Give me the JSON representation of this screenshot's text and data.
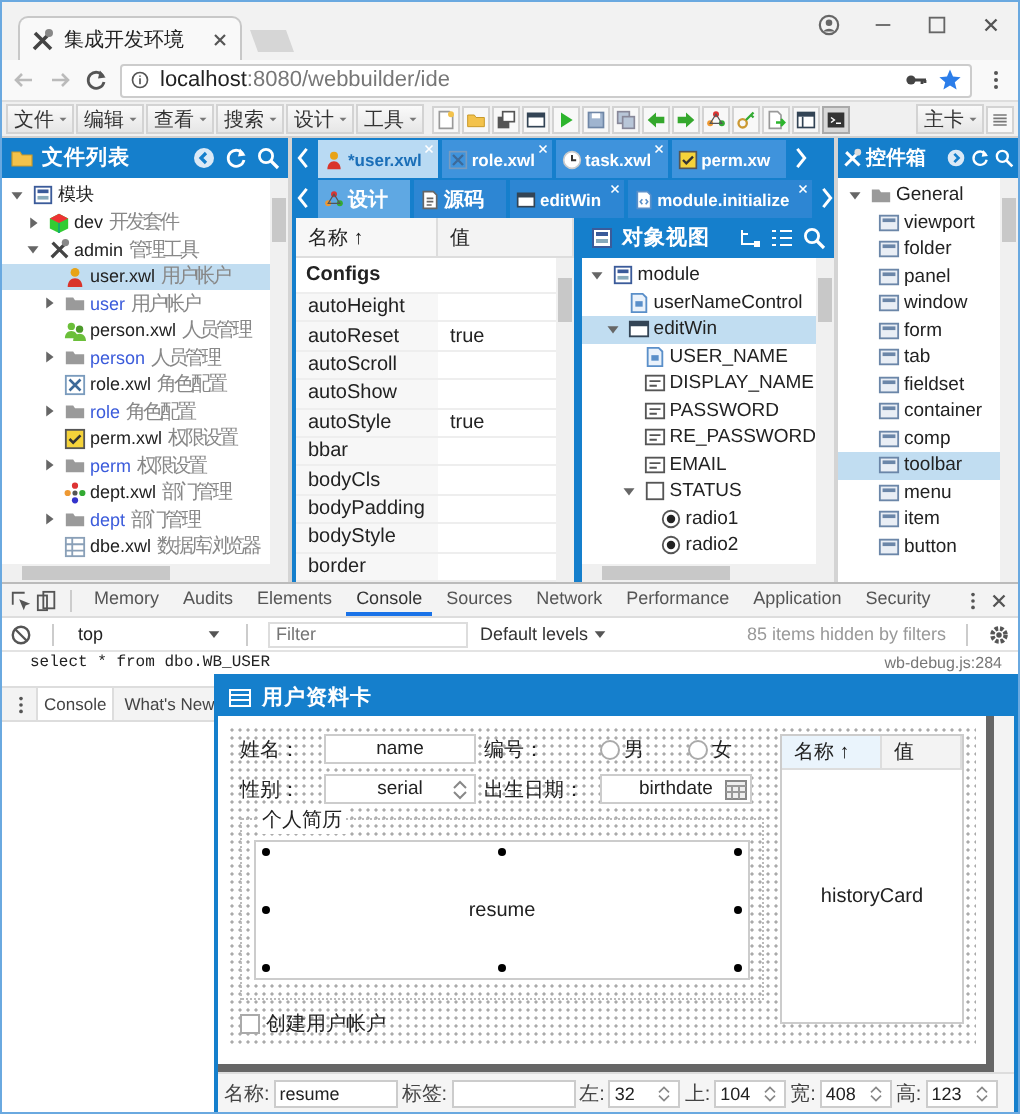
{
  "browser": {
    "tab_title": "集成开发环境",
    "url_host": "localhost",
    "url_path": ":8080/webbuilder/ide"
  },
  "menubar": {
    "menus": [
      "文件",
      "编辑",
      "查看",
      "搜索",
      "设计",
      "工具"
    ],
    "card_menu": "主卡"
  },
  "files": {
    "title": "文件列表",
    "tree": [
      {
        "label": "模块",
        "kind": "module",
        "expanded": true,
        "selected": false,
        "children": [
          {
            "label": "dev",
            "note": "开发套件",
            "kind": "kit",
            "expanded": false,
            "selected": false
          },
          {
            "label": "admin",
            "note": "管理工具",
            "kind": "tools",
            "expanded": true,
            "selected": false,
            "children": [
              {
                "label": "user.xwl",
                "note": "用户帐户",
                "kind": "user",
                "selected": true
              },
              {
                "label": "user",
                "note": "用户帐户",
                "kind": "folder",
                "expanded": false,
                "selected": false
              },
              {
                "label": "person.xwl",
                "note": "人员管理",
                "kind": "people",
                "selected": false
              },
              {
                "label": "person",
                "note": "人员管理",
                "kind": "folder",
                "expanded": false,
                "selected": false
              },
              {
                "label": "role.xwl",
                "note": "角色配置",
                "kind": "role",
                "selected": false
              },
              {
                "label": "role",
                "note": "角色配置",
                "kind": "folder",
                "expanded": false,
                "selected": false
              },
              {
                "label": "perm.xwl",
                "note": "权限设置",
                "kind": "perm",
                "selected": false
              },
              {
                "label": "perm",
                "note": "权限设置",
                "kind": "folder",
                "expanded": false,
                "selected": false
              },
              {
                "label": "dept.xwl",
                "note": "部门管理",
                "kind": "dept",
                "selected": false
              },
              {
                "label": "dept",
                "note": "部门管理",
                "kind": "folder",
                "expanded": false,
                "selected": false
              },
              {
                "label": "dbe.xwl",
                "note": "数据库浏览器",
                "kind": "db",
                "selected": false
              }
            ]
          }
        ]
      }
    ]
  },
  "editor": {
    "tabs": [
      {
        "label": "*user.xwl",
        "kind": "user",
        "selected": true,
        "closable": true
      },
      {
        "label": "role.xwl",
        "kind": "role",
        "selected": false,
        "closable": true
      },
      {
        "label": "task.xwl",
        "kind": "task",
        "selected": false,
        "closable": true
      },
      {
        "label": "perm.xw",
        "kind": "perm",
        "selected": false,
        "closable": false
      }
    ],
    "subtabs": [
      {
        "label": "设计",
        "kind": "design",
        "selected": true,
        "closable": false
      },
      {
        "label": "源码",
        "kind": "source",
        "selected": false,
        "closable": false
      },
      {
        "label": "editWin",
        "kind": "window",
        "selected": false,
        "closable": true
      },
      {
        "label": "module.initialize",
        "kind": "script",
        "selected": false,
        "closable": true
      }
    ],
    "properties": {
      "columns": [
        "名称 ↑",
        "值"
      ],
      "group": "Configs",
      "rows": [
        {
          "name": "autoHeight"
        },
        {
          "name": "autoReset",
          "value": "true"
        },
        {
          "name": "autoScroll"
        },
        {
          "name": "autoShow"
        },
        {
          "name": "autoStyle",
          "value": "true"
        },
        {
          "name": "bbar"
        },
        {
          "name": "bodyCls"
        },
        {
          "name": "bodyPadding"
        },
        {
          "name": "bodyStyle"
        },
        {
          "name": "border"
        }
      ]
    },
    "objects": {
      "title": "对象视图",
      "tree": [
        {
          "label": "module",
          "kind": "module",
          "expanded": true,
          "selected": false,
          "children": [
            {
              "label": "userNameControl",
              "kind": "control",
              "selected": false
            },
            {
              "label": "editWin",
              "kind": "window",
              "expanded": true,
              "selected": true,
              "children": [
                {
                  "label": "USER_NAME",
                  "kind": "control",
                  "selected": false
                },
                {
                  "label": "DISPLAY_NAME",
                  "kind": "text",
                  "selected": false
                },
                {
                  "label": "PASSWORD",
                  "kind": "text",
                  "selected": false
                },
                {
                  "label": "RE_PASSWORD",
                  "kind": "text",
                  "selected": false
                },
                {
                  "label": "EMAIL",
                  "kind": "text",
                  "selected": false
                },
                {
                  "label": "STATUS",
                  "kind": "container",
                  "expanded": true,
                  "selected": false,
                  "children": [
                    {
                      "label": "radio1",
                      "kind": "radio",
                      "selected": false
                    },
                    {
                      "label": "radio2",
                      "kind": "radio",
                      "selected": false
                    }
                  ]
                }
              ]
            }
          ]
        }
      ]
    }
  },
  "toolbox": {
    "title": "控件箱",
    "group": {
      "label": "General",
      "expanded": true
    },
    "items": [
      {
        "label": "viewport",
        "selected": false
      },
      {
        "label": "folder",
        "selected": false
      },
      {
        "label": "panel",
        "selected": false
      },
      {
        "label": "window",
        "selected": false
      },
      {
        "label": "form",
        "selected": false
      },
      {
        "label": "tab",
        "selected": false
      },
      {
        "label": "fieldset",
        "selected": false
      },
      {
        "label": "container",
        "selected": false
      },
      {
        "label": "comp",
        "selected": false
      },
      {
        "label": "toolbar",
        "selected": true
      },
      {
        "label": "menu",
        "selected": false
      },
      {
        "label": "item",
        "selected": false
      },
      {
        "label": "button",
        "selected": false
      }
    ]
  },
  "devtools": {
    "tabs": [
      {
        "label": "Memory",
        "selected": false
      },
      {
        "label": "Audits",
        "selected": false
      },
      {
        "label": "Elements",
        "selected": false
      },
      {
        "label": "Console",
        "selected": true
      },
      {
        "label": "Sources",
        "selected": false
      },
      {
        "label": "Network",
        "selected": false
      },
      {
        "label": "Performance",
        "selected": false
      },
      {
        "label": "Application",
        "selected": false
      },
      {
        "label": "Security",
        "selected": false
      }
    ],
    "context": "top",
    "filter_placeholder": "Filter",
    "levels": "Default levels",
    "hidden_note": "85 items hidden by filters",
    "console": [
      {
        "text": "select * from dbo.WB_USER",
        "source": "wb-debug.js:284"
      }
    ],
    "drawer_tabs": [
      {
        "label": "Console",
        "selected": true
      },
      {
        "label": "What's New",
        "selected": false
      }
    ]
  },
  "designer": {
    "title": "用户资料卡",
    "fields": [
      {
        "label": "姓名：",
        "kind": "text",
        "value": "name"
      },
      {
        "label": "编号：",
        "kind": "radios",
        "options": [
          {
            "label": "男",
            "selected": false
          },
          {
            "label": "女",
            "selected": false
          }
        ]
      },
      {
        "label": "性别：",
        "kind": "spinner",
        "value": "serial"
      },
      {
        "label": "出生日期：",
        "kind": "date",
        "value": "birthdate"
      }
    ],
    "fieldset": {
      "legend": "个人简历",
      "value": "resume",
      "selected": true
    },
    "checkbox": {
      "label": "创建用户帐户",
      "checked": false
    },
    "grid": {
      "columns": [
        "名称 ↑",
        "值"
      ],
      "value": "historyCard"
    },
    "props": [
      {
        "label": "名称:",
        "kind": "text",
        "value": "resume"
      },
      {
        "label": "标签:",
        "kind": "text"
      },
      {
        "label": "左:",
        "kind": "number",
        "value": "32"
      },
      {
        "label": "上:",
        "kind": "number",
        "value": "104"
      },
      {
        "label": "宽:",
        "kind": "number",
        "value": "408"
      },
      {
        "label": "高:",
        "kind": "number",
        "value": "123"
      }
    ]
  }
}
